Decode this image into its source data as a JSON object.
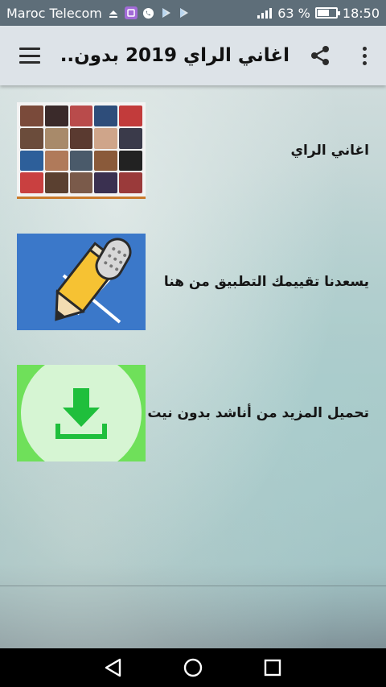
{
  "status_bar": {
    "carrier": "Maroc Telecom",
    "battery": "63 %",
    "battery_level": 0.63,
    "time": "18:50",
    "icons": [
      "upload-icon",
      "app-notification-icon",
      "whatsapp-icon",
      "play-store-icon",
      "play-store-icon",
      "signal-icon",
      "battery-icon"
    ]
  },
  "app_bar": {
    "title": "اغاني الراي 2019 بدون...",
    "menu_icon": "menu-icon",
    "share_icon": "share-icon",
    "more_icon": "more-vert-icon"
  },
  "items": [
    {
      "label": "اغاني الراي",
      "thumbnail": "singers-collage"
    },
    {
      "label": "يسعدنا تقييمك التطبيق من هنا",
      "thumbnail": "pencil-microphone-icon"
    },
    {
      "label": "تحميل المزيد من أناشد بدون نيت",
      "thumbnail": "download-icon"
    }
  ],
  "nav_bar": {
    "back_icon": "back-icon",
    "home_icon": "home-icon",
    "recents_icon": "recents-icon"
  },
  "colors": {
    "status_bar": "#5e6e79",
    "app_bar": "#dde3e8",
    "pencil_bg": "#3b78c9",
    "download_bg": "#6fe05a",
    "download_arrow": "#1fbf3c"
  }
}
